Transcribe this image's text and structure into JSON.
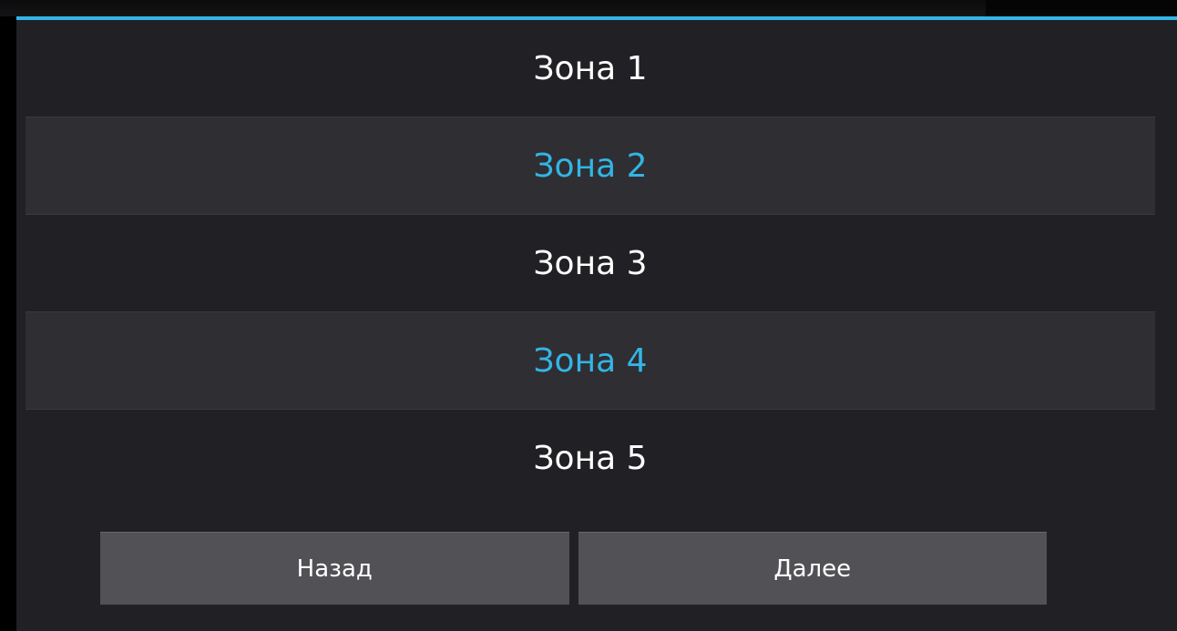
{
  "colors": {
    "accent": "#33b5e5",
    "background": "#212024",
    "selected_row": "#2f2e33",
    "button": "#525155",
    "text": "#ffffff"
  },
  "zones": [
    {
      "label": "Зона 1",
      "selected": false
    },
    {
      "label": "Зона 2",
      "selected": true
    },
    {
      "label": "Зона 3",
      "selected": false
    },
    {
      "label": "Зона 4",
      "selected": true
    },
    {
      "label": "Зона 5",
      "selected": false
    }
  ],
  "buttons": {
    "back_label": "Назад",
    "next_label": "Далее"
  }
}
